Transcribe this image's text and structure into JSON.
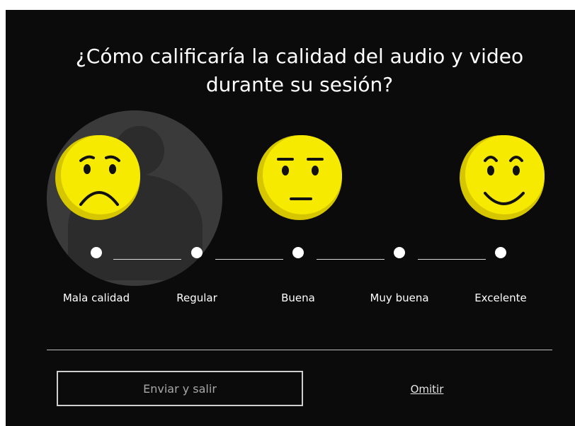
{
  "dialog": {
    "question_line1": "¿Cómo calificaría la calidad del audio y video",
    "question_line2": "durante su sesión?"
  },
  "faces": [
    {
      "name": "sad-face-icon",
      "mood": "sad"
    },
    {
      "name": "neutral-face-icon",
      "mood": "neutral"
    },
    {
      "name": "happy-face-icon",
      "mood": "happy"
    }
  ],
  "rating": {
    "options": [
      "Mala calidad",
      "Regular",
      "Buena",
      "Muy buena",
      "Excelente"
    ]
  },
  "actions": {
    "submit_label": "Enviar y salir",
    "skip_label": "Omitir"
  },
  "colors": {
    "background": "#0b0b0b",
    "face_yellow": "#f5ea00",
    "text": "#ffffff"
  }
}
